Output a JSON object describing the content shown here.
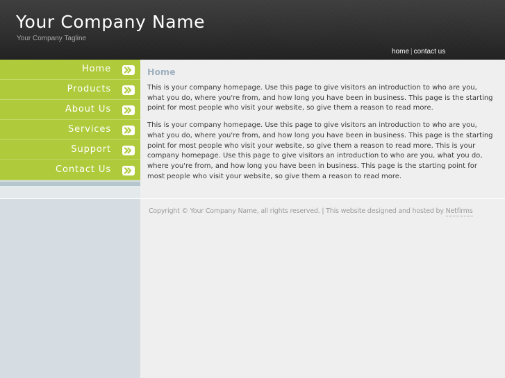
{
  "header": {
    "company_name": "Your Company Name",
    "tagline": "Your Company Tagline",
    "top_nav": {
      "home": "home",
      "separator": "|",
      "contact": "contact us"
    }
  },
  "sidebar": {
    "items": [
      {
        "label": "Home"
      },
      {
        "label": "Products"
      },
      {
        "label": "About Us"
      },
      {
        "label": "Services"
      },
      {
        "label": "Support"
      },
      {
        "label": "Contact Us"
      }
    ]
  },
  "main": {
    "title": "Home",
    "paragraphs": [
      "This is your company homepage. Use this page to give visitors an introduction to who are you, what you do, where you're from, and how long you have been in business. This page is the starting point for most people who visit your website, so give them a reason to read more.",
      "This is your company homepage. Use this page to give visitors an introduction to who are you, what you do, where you're from, and how long you have been in business. This page is the starting point for most people who visit your website, so give them a reason to read more. This is your company homepage. Use this page to give visitors an introduction to who are you, what you do, where you're from, and how long you have been in business. This page is the starting point for most people who visit your website, so give them a reason to read more."
    ]
  },
  "footer": {
    "text": "Copyright © Your Company Name, all rights reserved. | This website designed and hosted by ",
    "link": "Netfirms"
  },
  "colors": {
    "menu_green": "#afca3a",
    "sidebar_blue_gray": "#d5dde2",
    "title_blue_gray": "#9fb1bf",
    "header_dark": "#2a2a2a"
  },
  "icons": {
    "menu_arrow": "double-chevron-right-icon"
  }
}
